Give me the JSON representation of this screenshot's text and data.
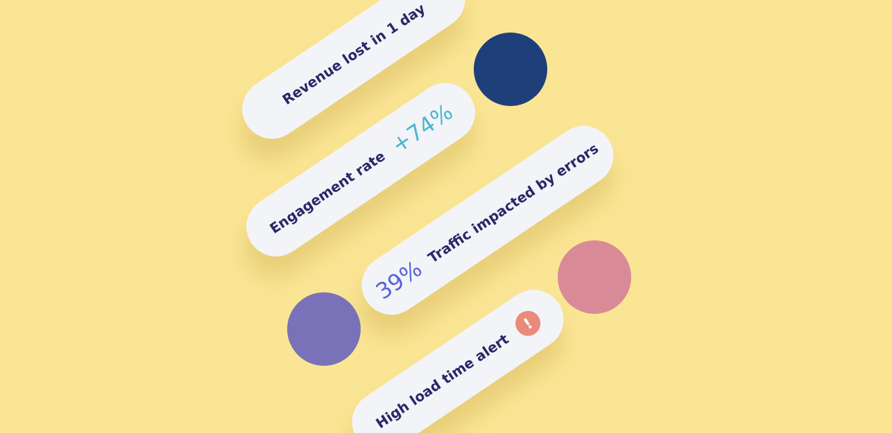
{
  "pills": [
    {
      "kind": "plain",
      "label": "Revenue lost in 1 day"
    },
    {
      "kind": "stat_after",
      "label": "Engagement rate",
      "stat": "+74%"
    },
    {
      "kind": "stat_before",
      "label": "Traffic impacted by errors",
      "stat": "39%"
    },
    {
      "kind": "alert",
      "label": "High load time alert",
      "icon": "!"
    }
  ]
}
